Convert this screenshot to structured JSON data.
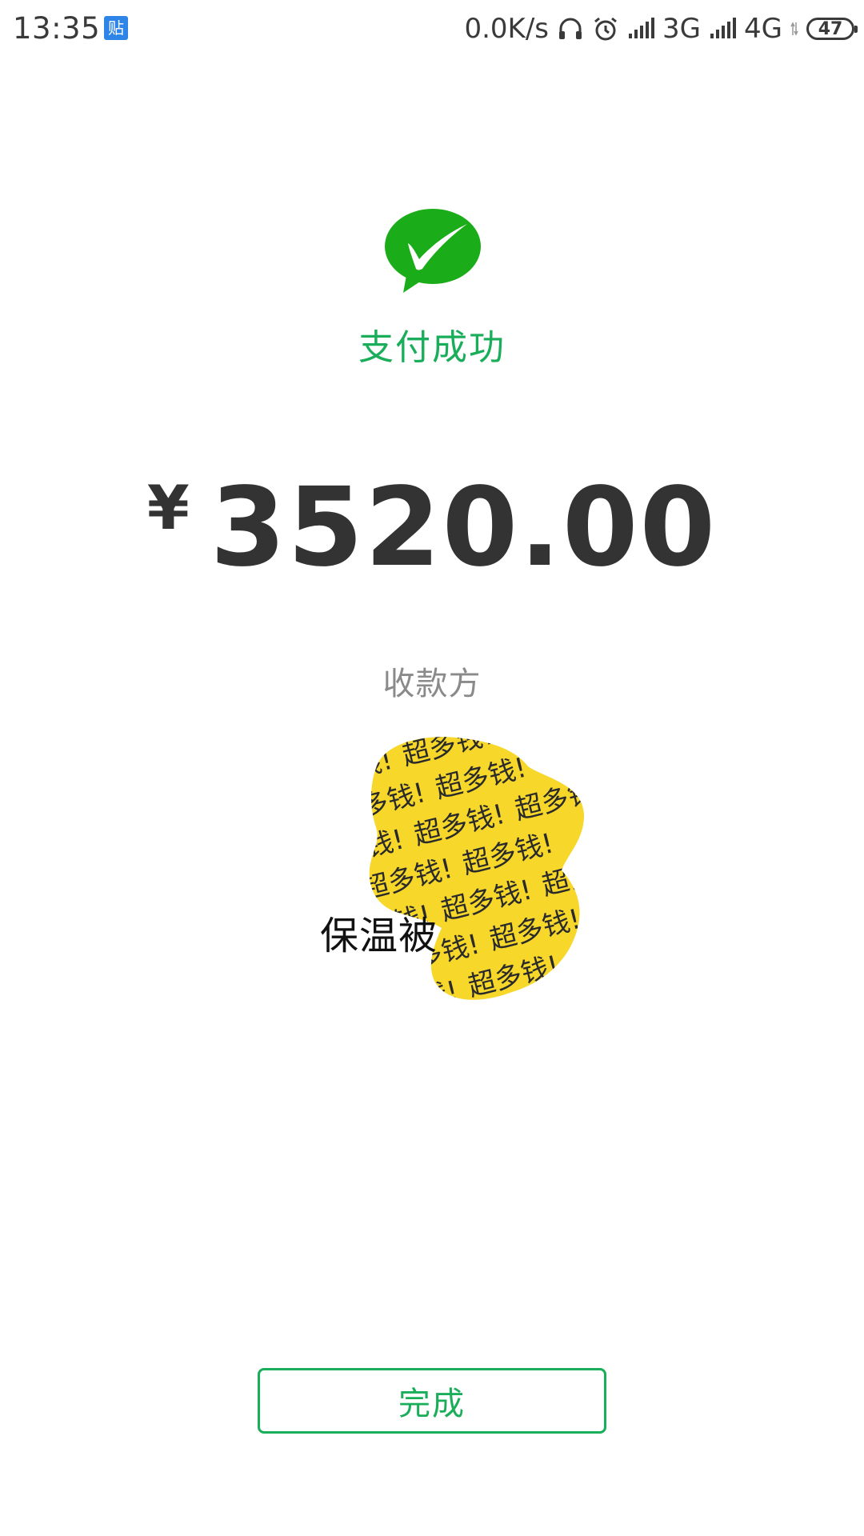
{
  "status_bar": {
    "time": "13:35",
    "app_icon_text": "贴",
    "network_speed": "0.0K/s",
    "signal_1": "3G",
    "signal_2": "4G",
    "battery": "47"
  },
  "icons": {
    "wechat_pay": "wechat-pay-check-icon",
    "headphones": "headphones-icon",
    "alarm": "alarm-icon"
  },
  "colors": {
    "accent": "#1aad5a",
    "amount": "#333333",
    "payee_label": "#8a8a8a",
    "sticker_yellow": "#f6d72a"
  },
  "result": {
    "title": "支付成功"
  },
  "amount": {
    "symbol": "¥",
    "value": "3520.00"
  },
  "payee": {
    "label": "收款方",
    "name": "保温被",
    "sticker_text": "超多钱!"
  },
  "actions": {
    "done_label": "完成"
  }
}
